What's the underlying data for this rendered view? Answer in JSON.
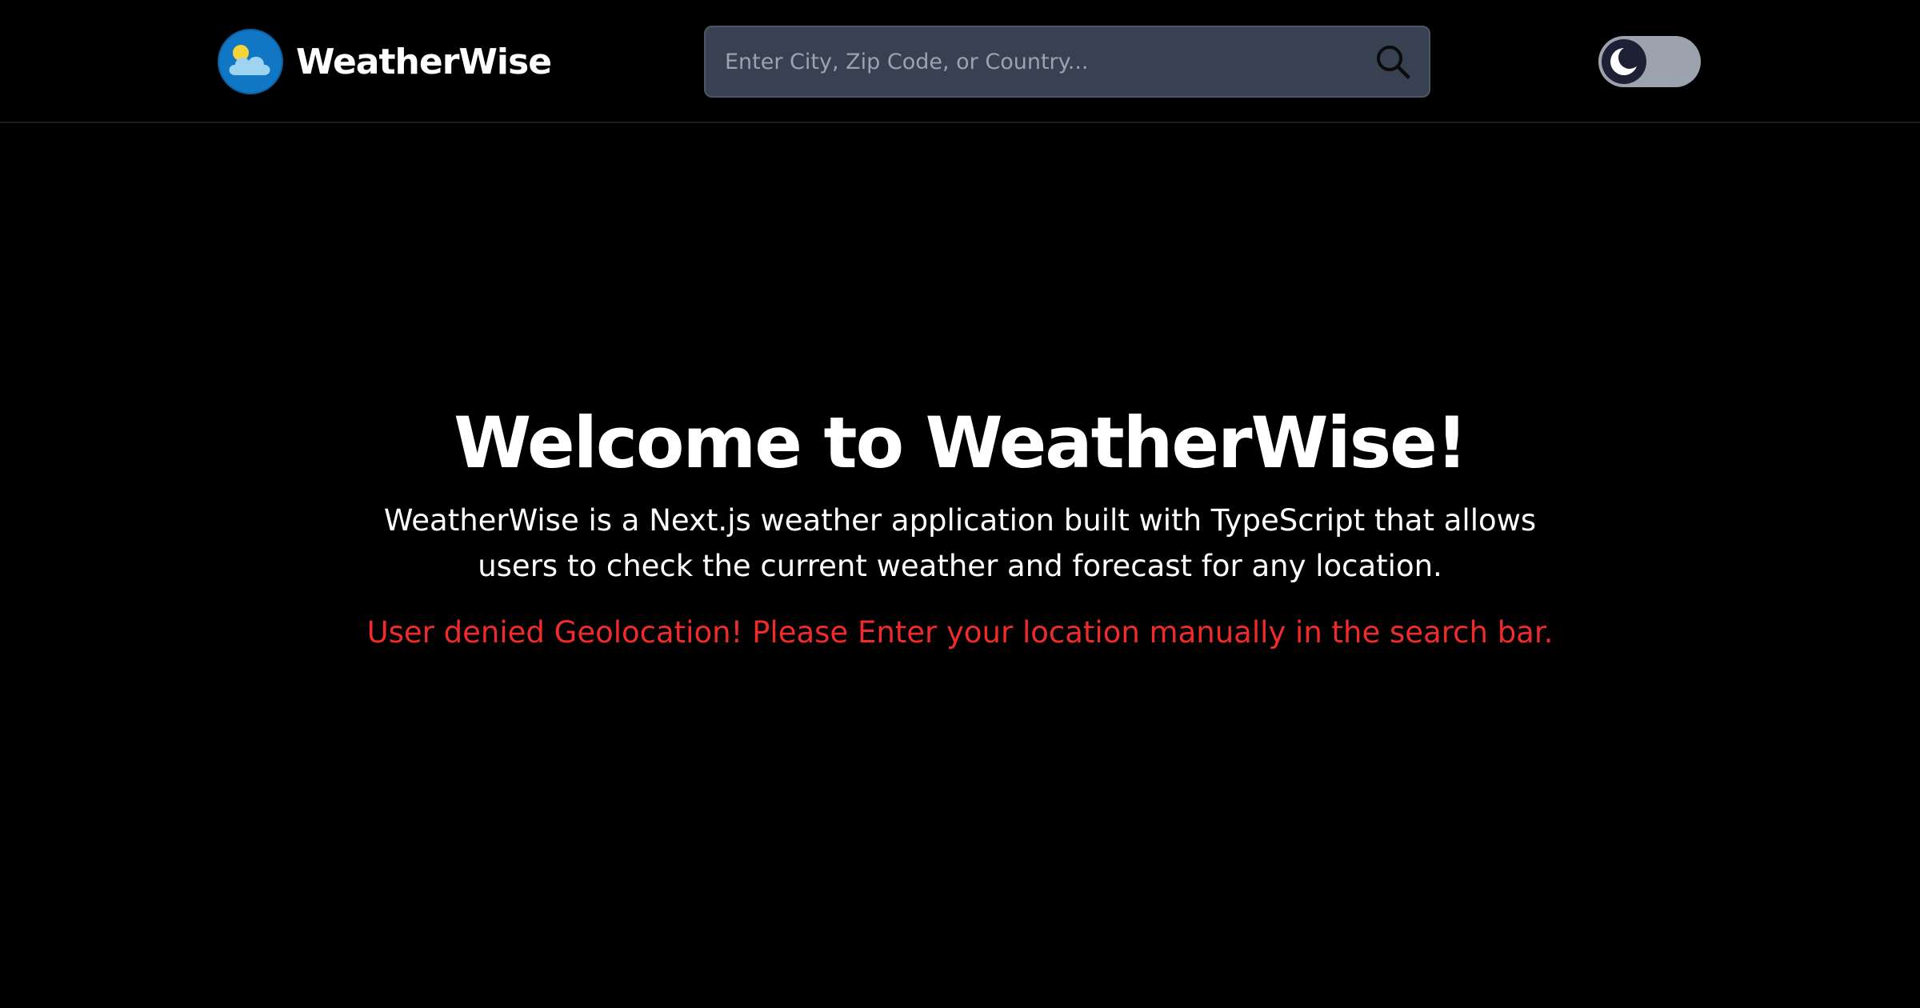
{
  "header": {
    "brand_name": "WeatherWise",
    "logo_icon": "sun-cloud-logo-icon",
    "search": {
      "placeholder": "Enter City, Zip Code, or Country...",
      "value": "",
      "icon": "search-icon"
    },
    "theme_toggle": {
      "state": "dark",
      "icon": "moon-icon"
    }
  },
  "main": {
    "title": "Welcome to WeatherWise!",
    "description": "WeatherWise is a Next.js weather application built with TypeScript that allows users to check the current weather and forecast for any location.",
    "error_message": "User denied Geolocation! Please Enter your location manually in the search bar."
  },
  "colors": {
    "background": "#000000",
    "search_background": "#374151",
    "toggle_track": "#9ca3af",
    "toggle_knob": "#1e2135",
    "error_text": "#ef2b2b",
    "logo_blue": "#1177c4"
  }
}
